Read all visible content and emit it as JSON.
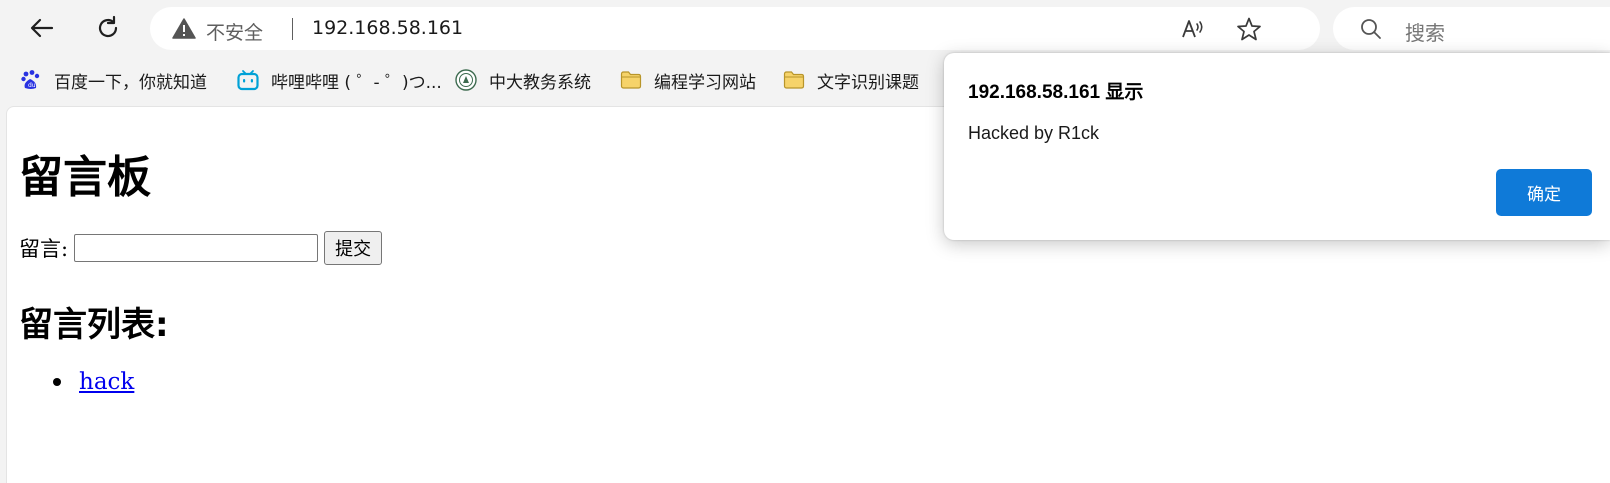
{
  "toolbar": {
    "back_icon": "back-arrow-icon",
    "reload_icon": "reload-icon",
    "security_label": "不安全",
    "url": "192.168.58.161",
    "read_aloud_icon": "read-aloud-icon",
    "favorite_icon": "star-icon",
    "search_placeholder": "搜索"
  },
  "bookmarks": [
    {
      "label": "百度一下，你就知道",
      "icon": "baidu-icon"
    },
    {
      "label": "哔哩哔哩 ( ゜- ゜)つ...",
      "icon": "bilibili-icon"
    },
    {
      "label": "中大教务系统",
      "icon": "university-icon"
    },
    {
      "label": "编程学习网站",
      "icon": "folder-icon"
    },
    {
      "label": "文字识别课题",
      "icon": "folder-icon"
    }
  ],
  "page": {
    "title": "留言板",
    "form_label": "留言:",
    "input_value": "",
    "submit_label": "提交",
    "list_title": "留言列表:",
    "messages": [
      "hack"
    ]
  },
  "dialog": {
    "title": "192.168.58.161 显示",
    "message": "Hacked by R1ck",
    "ok_label": "确定"
  },
  "colors": {
    "toolbar_bg": "#f3f3f3",
    "dialog_button": "#0f7ad8",
    "link": "#0000ee"
  }
}
